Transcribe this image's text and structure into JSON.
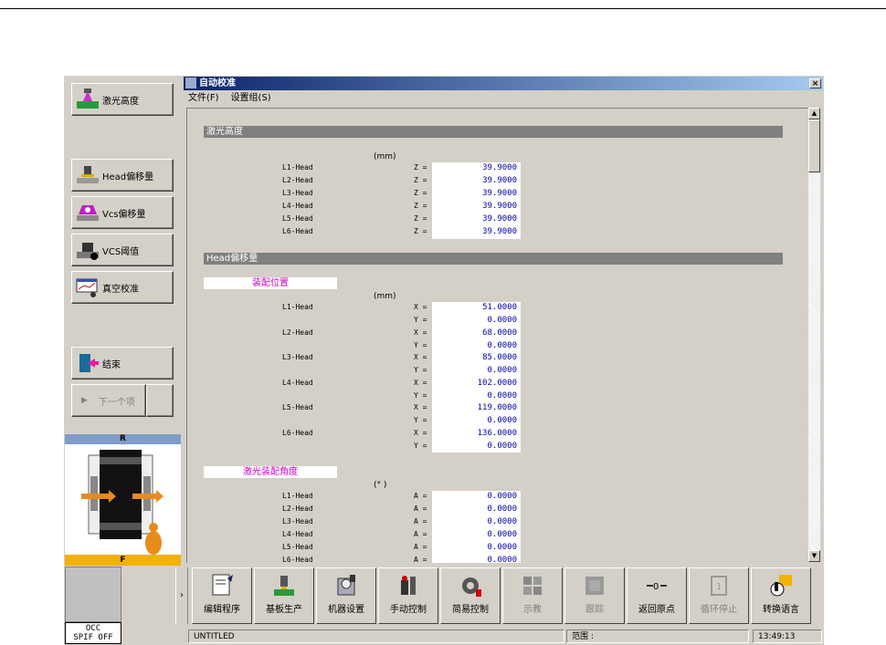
{
  "window": {
    "title": "自动校准",
    "close": "×"
  },
  "menu": [
    "文件(F)",
    "设置组(S)"
  ],
  "left_buttons": [
    {
      "label": "激光高度",
      "icon": "laser-height-icon"
    },
    {
      "label": "Head偏移量",
      "icon": "head-offset-icon"
    },
    {
      "label": "Vcs偏移量",
      "icon": "vcs-offset-icon"
    },
    {
      "label": "VCS阈值",
      "icon": "vcs-threshold-icon"
    },
    {
      "label": "真空校准",
      "icon": "vacuum-calibration-icon"
    },
    {
      "label": "结束",
      "icon": "exit-door-icon"
    }
  ],
  "next_item": "下一个项",
  "machine_view": {
    "top": "R",
    "bottom": "F"
  },
  "sections": {
    "laser_height": {
      "title": "激光高度",
      "unit": "(mm)",
      "rows": [
        {
          "head": "L1-Head",
          "axis": "Z =",
          "value": "39.9000"
        },
        {
          "head": "L2-Head",
          "axis": "Z =",
          "value": "39.9000"
        },
        {
          "head": "L3-Head",
          "axis": "Z =",
          "value": "39.9000"
        },
        {
          "head": "L4-Head",
          "axis": "Z =",
          "value": "39.9000"
        },
        {
          "head": "L5-Head",
          "axis": "Z =",
          "value": "39.9000"
        },
        {
          "head": "L6-Head",
          "axis": "Z =",
          "value": "39.9000"
        }
      ]
    },
    "head_offset": {
      "title": "Head偏移量",
      "sub": "装配位置",
      "unit": "(mm)",
      "rows": [
        {
          "head": "L1-Head",
          "x": "51.0000",
          "y": "0.0000"
        },
        {
          "head": "L2-Head",
          "x": "68.0000",
          "y": "0.0000"
        },
        {
          "head": "L3-Head",
          "x": "85.0000",
          "y": "0.0000"
        },
        {
          "head": "L4-Head",
          "x": "102.0000",
          "y": "0.0000"
        },
        {
          "head": "L5-Head",
          "x": "119.0000",
          "y": "0.0000"
        },
        {
          "head": "L6-Head",
          "x": "136.0000",
          "y": "0.0000"
        }
      ],
      "x_label": "X =",
      "y_label": "Y ="
    },
    "laser_angle": {
      "sub": "激光装配角度",
      "unit": "(° )",
      "rows": [
        {
          "head": "L1-Head",
          "axis": "A =",
          "value": "0.0000"
        },
        {
          "head": "L2-Head",
          "axis": "A =",
          "value": "0.0000"
        },
        {
          "head": "L3-Head",
          "axis": "A =",
          "value": "0.0000"
        },
        {
          "head": "L4-Head",
          "axis": "A =",
          "value": "0.0000"
        },
        {
          "head": "L5-Head",
          "axis": "A =",
          "value": "0.0000"
        },
        {
          "head": "L6-Head",
          "axis": "A =",
          "value": "0.0000"
        }
      ]
    }
  },
  "occ": {
    "line1": "OCC",
    "line2": "SPIF OFF"
  },
  "chevron": "›",
  "toolbar": [
    {
      "label": "编辑程序",
      "icon": "edit-program-icon",
      "enabled": true
    },
    {
      "label": "基板生产",
      "icon": "production-icon",
      "enabled": true
    },
    {
      "label": "机器设置",
      "icon": "machine-setup-icon",
      "enabled": true
    },
    {
      "label": "手动控制",
      "icon": "manual-control-icon",
      "enabled": true
    },
    {
      "label": "简易控制",
      "icon": "simple-control-icon",
      "enabled": true
    },
    {
      "label": "示教",
      "icon": "teach-icon",
      "enabled": false
    },
    {
      "label": "跟踪",
      "icon": "trace-icon",
      "enabled": false
    },
    {
      "label": "返回原点",
      "icon": "return-origin-icon",
      "enabled": true
    },
    {
      "label": "循环停止",
      "icon": "cycle-stop-icon",
      "enabled": false
    },
    {
      "label": "转换语言",
      "icon": "change-language-icon",
      "enabled": true
    }
  ],
  "status": {
    "file": "UNTITLED",
    "range": "范围 :",
    "time": "13:49:13"
  },
  "colors": {
    "title_start": "#0a246a",
    "title_end": "#a6caf0",
    "section_bg": "#808080",
    "sub_text": "#cc00cc",
    "value_text": "#0000aa"
  }
}
